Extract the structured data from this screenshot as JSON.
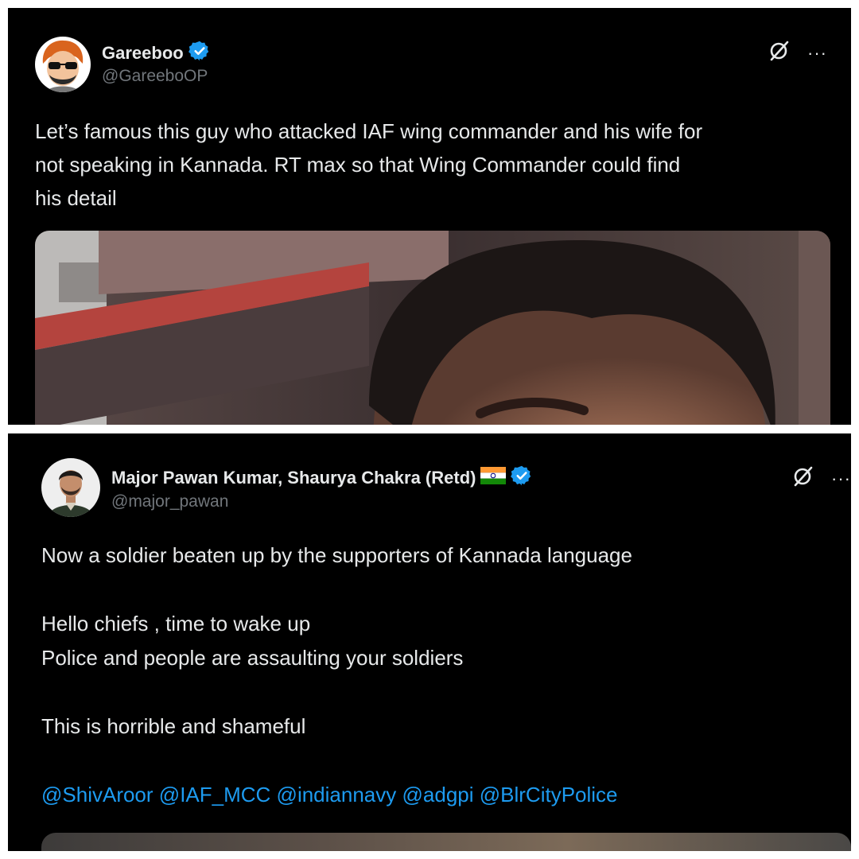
{
  "tweet1": {
    "display_name": "Gareeboo",
    "handle": "@GareeboOP",
    "text": "Let’s famous this guy who attacked IAF wing commander and his wife for\nnot speaking in Kannada. RT max so that Wing Commander could find\nhis detail",
    "more_label": "···",
    "media_alt": "photo of a man's face"
  },
  "tweet2": {
    "display_name": "Major Pawan Kumar, Shaurya Chakra (Retd)",
    "handle": "@major_pawan",
    "text": "Now a soldier beaten up by the supporters of Kannada language\n\nHello chiefs , time to wake up\nPolice and people are assaulting your soldiers\n\nThis is horrible and shameful",
    "mentions": [
      "@ShivAroor",
      "@IAF_MCC",
      "@indiannavy",
      "@adgpi",
      "@BlrCityPolice"
    ],
    "more_label": "···"
  },
  "colors": {
    "background": "#000000",
    "text": "#e7e9ea",
    "handle": "#71767b",
    "link": "#1d9bf0",
    "verified": "#1d9bf0"
  },
  "icons": [
    "verified-badge-icon",
    "grok-icon",
    "more-icon",
    "india-flag-icon"
  ]
}
